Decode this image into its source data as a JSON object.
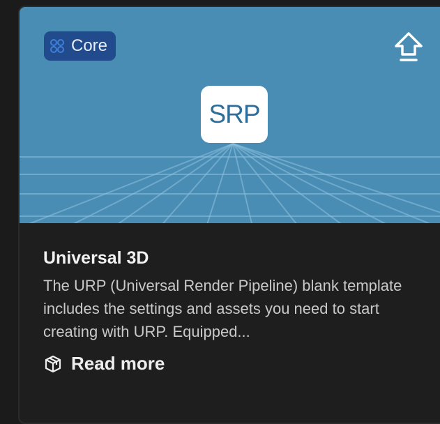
{
  "card": {
    "badge_label": "Core",
    "logo_text": "SRP",
    "title": "Universal 3D",
    "description": "The URP (Universal Render Pipeline) blank template includes the settings and assets you need to start creating with URP. Equipped...",
    "read_more_label": "Read more",
    "icons": {
      "badge": "core-grid-icon",
      "top_right": "upload-icon",
      "read_more": "package-box-icon"
    }
  },
  "colors": {
    "banner_background": "#4a8db4",
    "badge_background": "#214b8c",
    "card_background": "#1e1e1e",
    "page_background": "#1b1b1b",
    "logo_text": "#2f6e9a"
  }
}
